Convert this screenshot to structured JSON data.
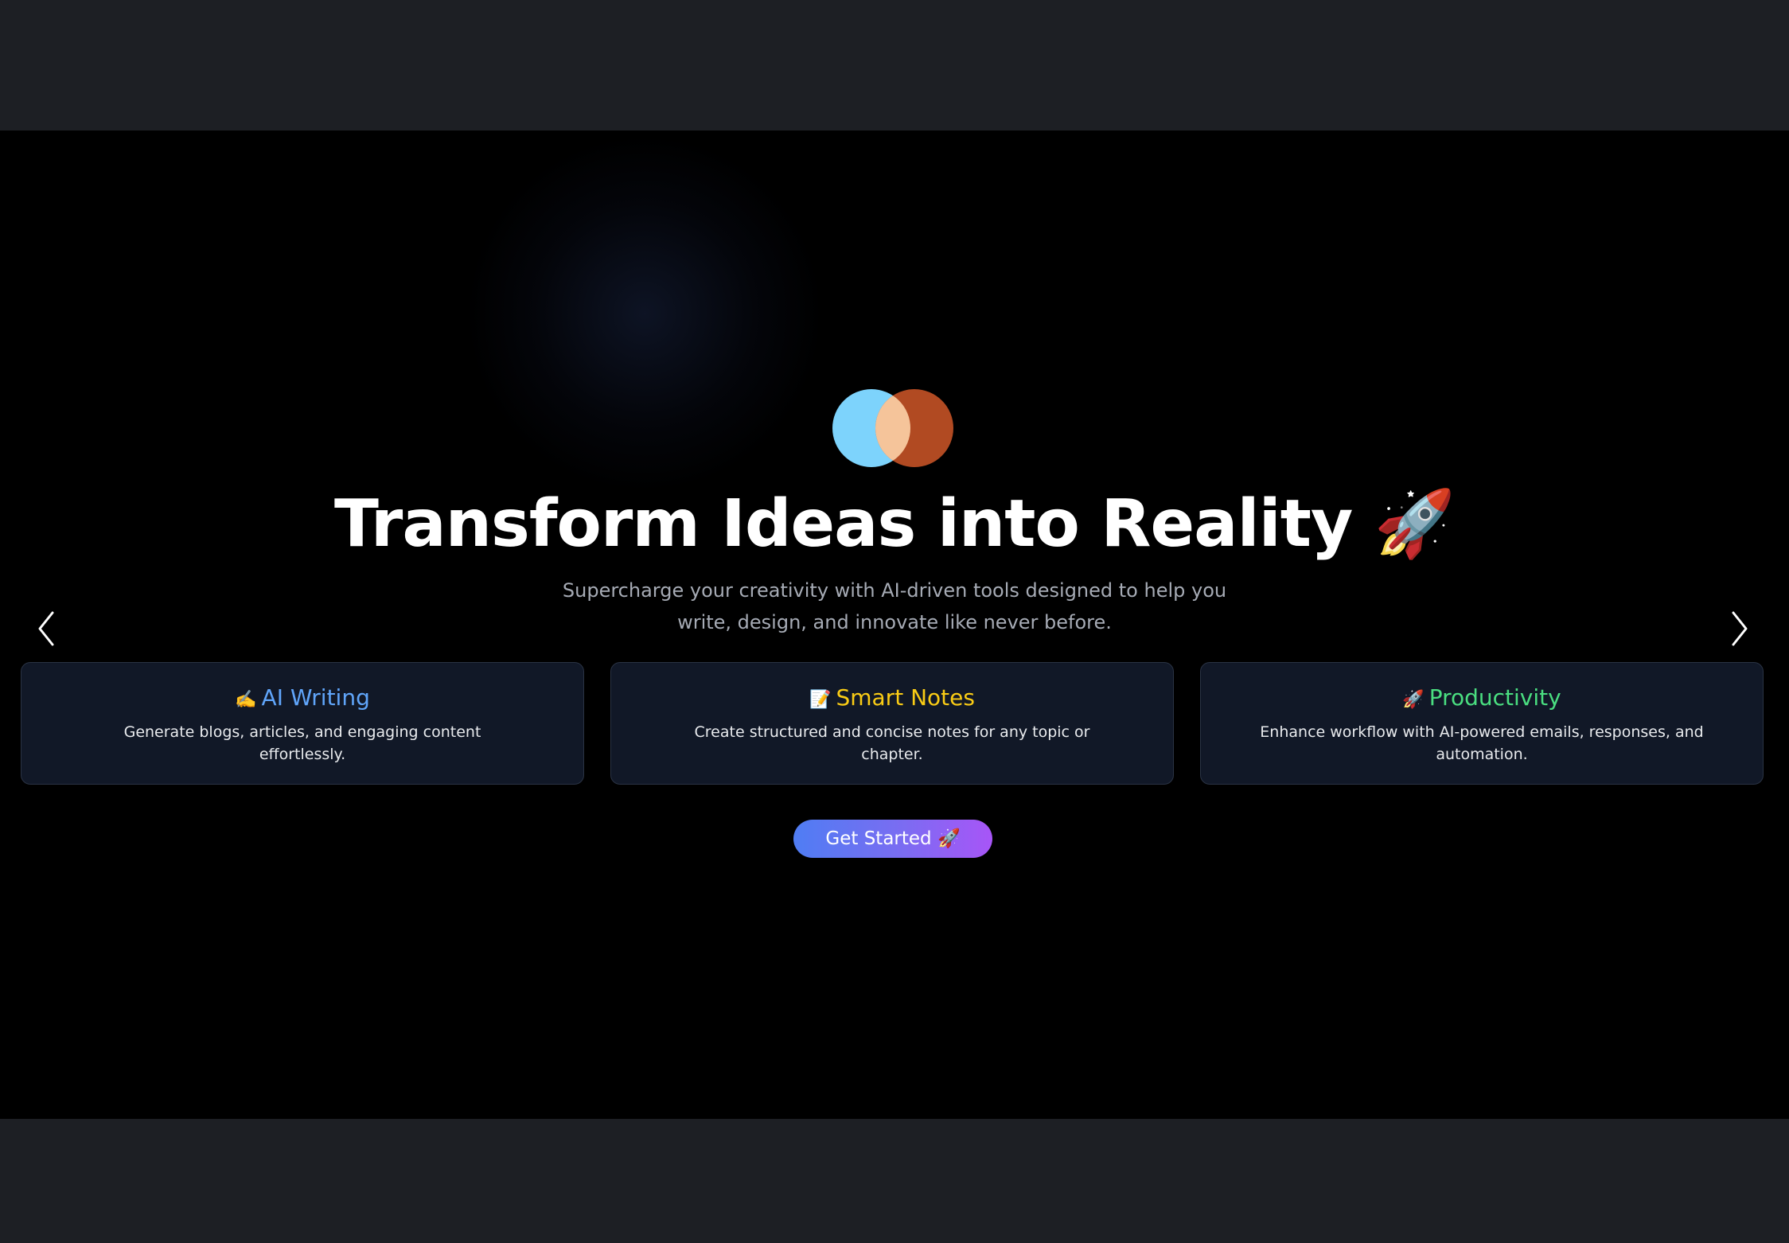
{
  "hero": {
    "headline": "Transform Ideas into Reality 🚀",
    "subtitle": "Supercharge your creativity with AI-driven tools designed to help you write, design, and innovate like never before."
  },
  "logo": {
    "icon": "overlapping-circles-logo",
    "colors": [
      "#7dd3fc",
      "#f5c49a",
      "#b14a22"
    ]
  },
  "carousel": {
    "prev_icon": "chevron-left-icon",
    "next_icon": "chevron-right-icon"
  },
  "features": [
    {
      "emoji": "✍️",
      "title": "AI Writing",
      "description": "Generate blogs, articles, and engaging content effortlessly.",
      "color": "#60a5fa"
    },
    {
      "emoji": "📝",
      "title": "Smart Notes",
      "description": "Create structured and concise notes for any topic or chapter.",
      "color": "#facc15"
    },
    {
      "emoji": "🚀",
      "title": "Productivity",
      "description": "Enhance workflow with AI-powered emails, responses, and automation.",
      "color": "#4ade80"
    }
  ],
  "cta": {
    "label": "Get Started 🚀"
  }
}
